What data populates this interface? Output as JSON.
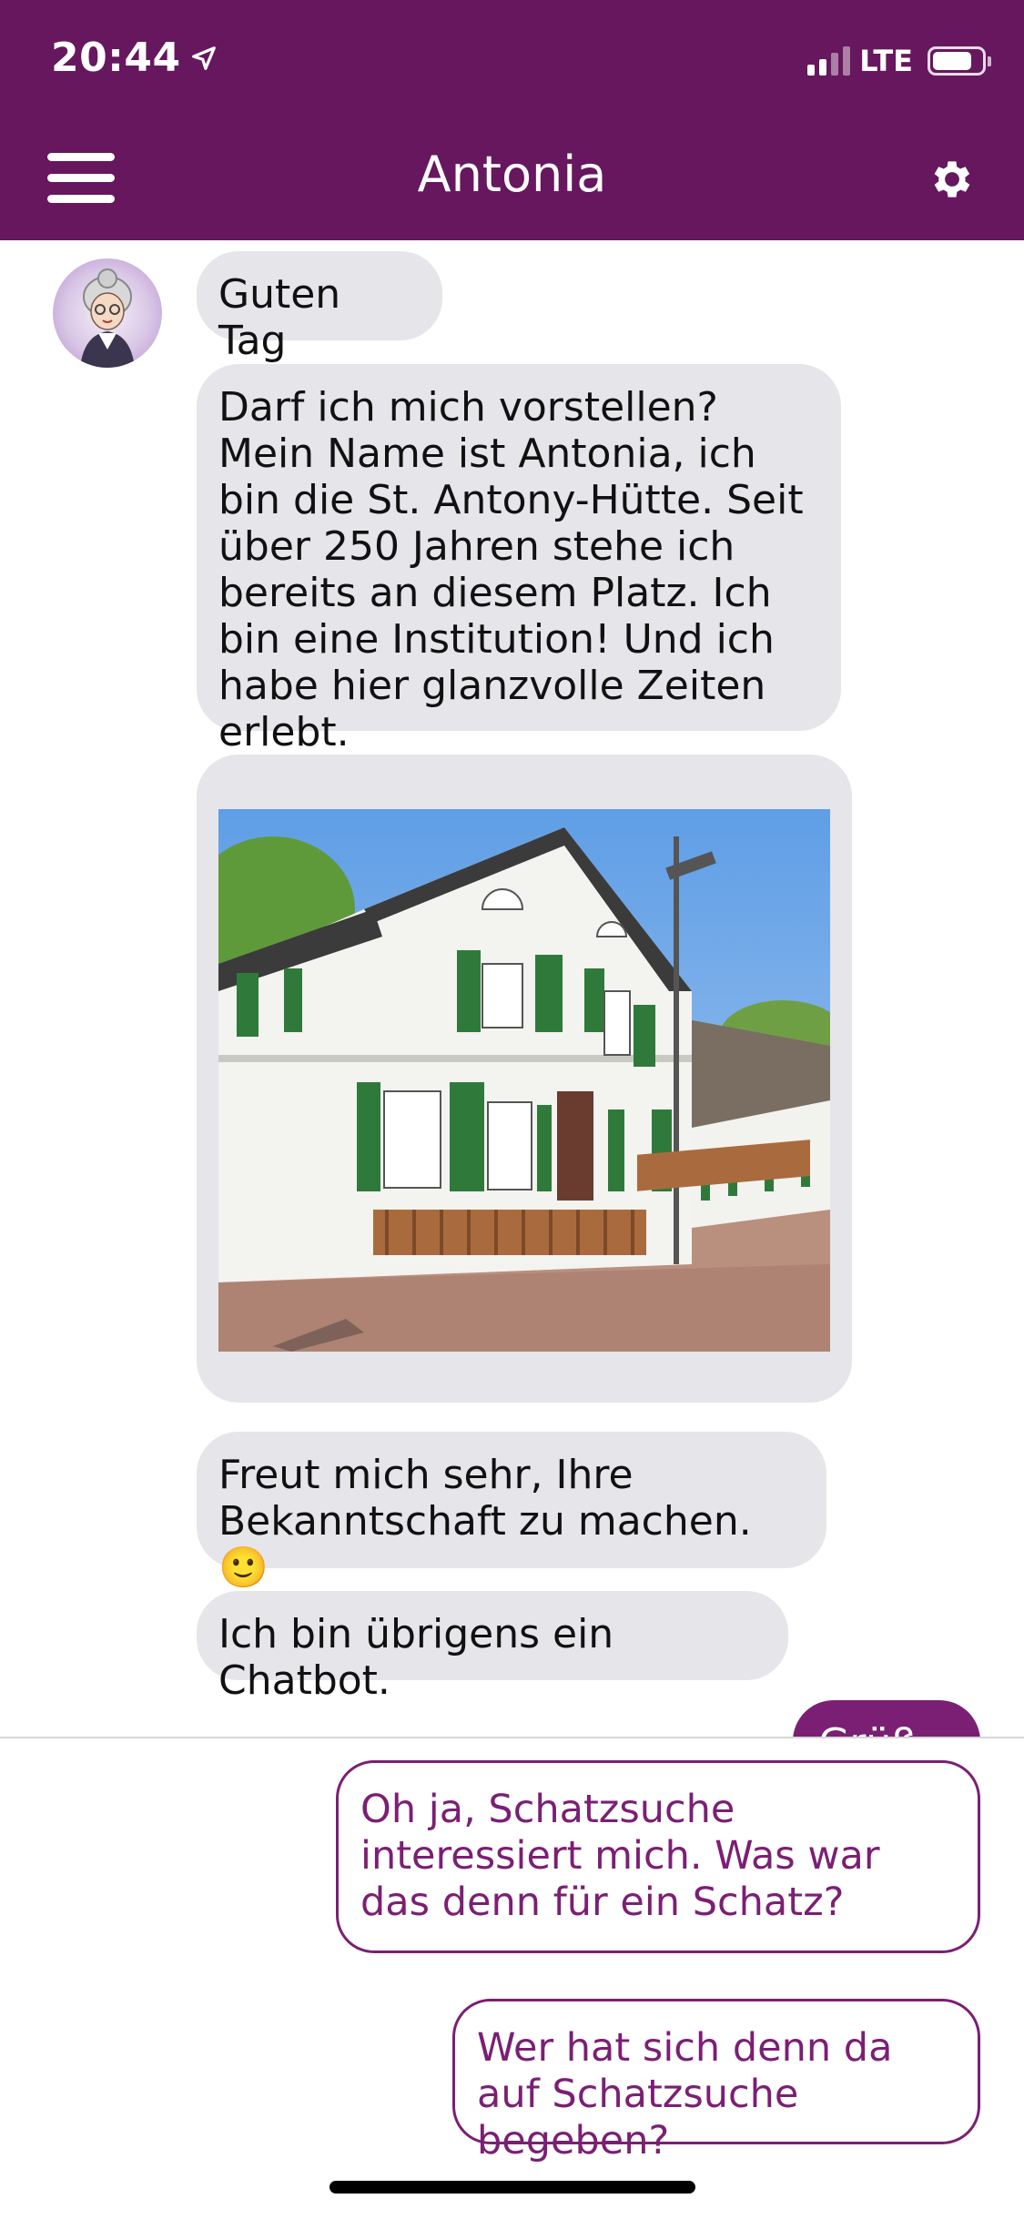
{
  "status_bar": {
    "time": "20:44",
    "network": "LTE",
    "battery_level": 0.8
  },
  "header": {
    "title": "Antonia"
  },
  "chat": {
    "bot_messages": [
      "Guten Tag",
      "Darf ich mich vorstellen? Mein Name ist Antonia, ich bin die St. Antony-Hütte. Seit über 250 Jahren stehe ich bereits an diesem Platz. Ich bin eine Institution! Und ich habe hier glanzvolle Zeiten erlebt.",
      "Freut mich sehr, Ihre Bekanntschaft zu machen. 🙂",
      "Ich bin übrigens ein Chatbot."
    ],
    "user_message_partial": "Grüß...",
    "colors": {
      "brand": "#66175e",
      "accent": "#7b1f74",
      "bot_bubble": "#e5e5ea"
    }
  },
  "quick_replies": [
    "Oh ja, Schatzsuche interessiert mich. Was war das denn für ein Schatz?",
    "Wer hat sich denn da auf Schatzsuche begeben?"
  ]
}
